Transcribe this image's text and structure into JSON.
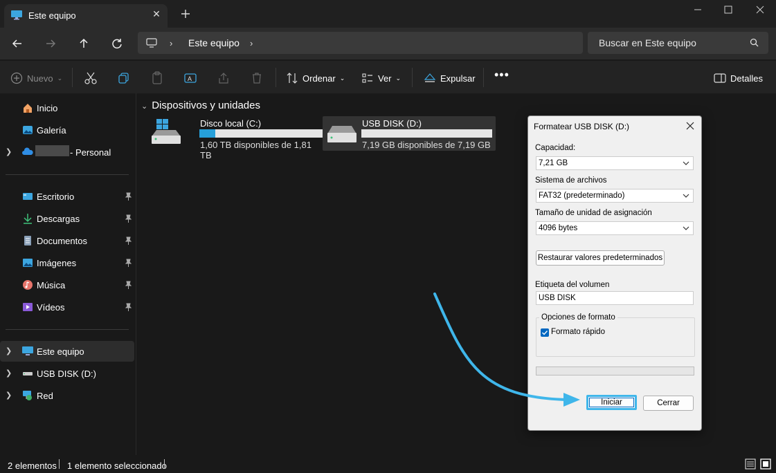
{
  "window": {
    "tab_title": "Este equipo",
    "minimize": "Minimizar",
    "maximize": "Maximizar",
    "close": "Cerrar"
  },
  "address": {
    "path": "Este equipo",
    "search_placeholder": "Buscar en Este equipo"
  },
  "toolbar": {
    "new": "Nuevo",
    "sort": "Ordenar",
    "view": "Ver",
    "eject": "Expulsar",
    "details": "Detalles"
  },
  "sidebar": {
    "home": "Inicio",
    "gallery": "Galería",
    "personal": "- Personal",
    "desktop": "Escritorio",
    "downloads": "Descargas",
    "documents": "Documentos",
    "pictures": "Imágenes",
    "music": "Música",
    "videos": "Vídeos",
    "this_pc": "Este equipo",
    "usb": "USB DISK (D:)",
    "network": "Red"
  },
  "content": {
    "group_header": "Dispositivos y unidades",
    "drives": [
      {
        "name": "Disco local (C:)",
        "free": "1,60 TB disponibles de 1,81 TB",
        "used_fraction": 0.12
      },
      {
        "name": "USB DISK (D:)",
        "free": "7,19 GB disponibles de 7,19 GB",
        "used_fraction": 0.0
      }
    ]
  },
  "status": {
    "count": "2 elementos",
    "selected": "1 elemento seleccionado"
  },
  "dialog": {
    "title": "Formatear USB DISK (D:)",
    "capacity_label": "Capacidad:",
    "capacity_value": "7,21 GB",
    "fs_label": "Sistema de archivos",
    "fs_value": "FAT32 (predeterminado)",
    "alloc_label": "Tamaño de unidad de asignación",
    "alloc_value": "4096 bytes",
    "restore_button": "Restaurar valores predeterminados",
    "volume_label": "Etiqueta del volumen",
    "volume_value": "USB DISK",
    "options_title": "Opciones de formato",
    "quick_format": "Formato rápido",
    "quick_format_checked": true,
    "start_button": "Iniciar",
    "close_button": "Cerrar"
  },
  "colors": {
    "accent": "#26a0da",
    "arrow": "#3fb6ea"
  }
}
